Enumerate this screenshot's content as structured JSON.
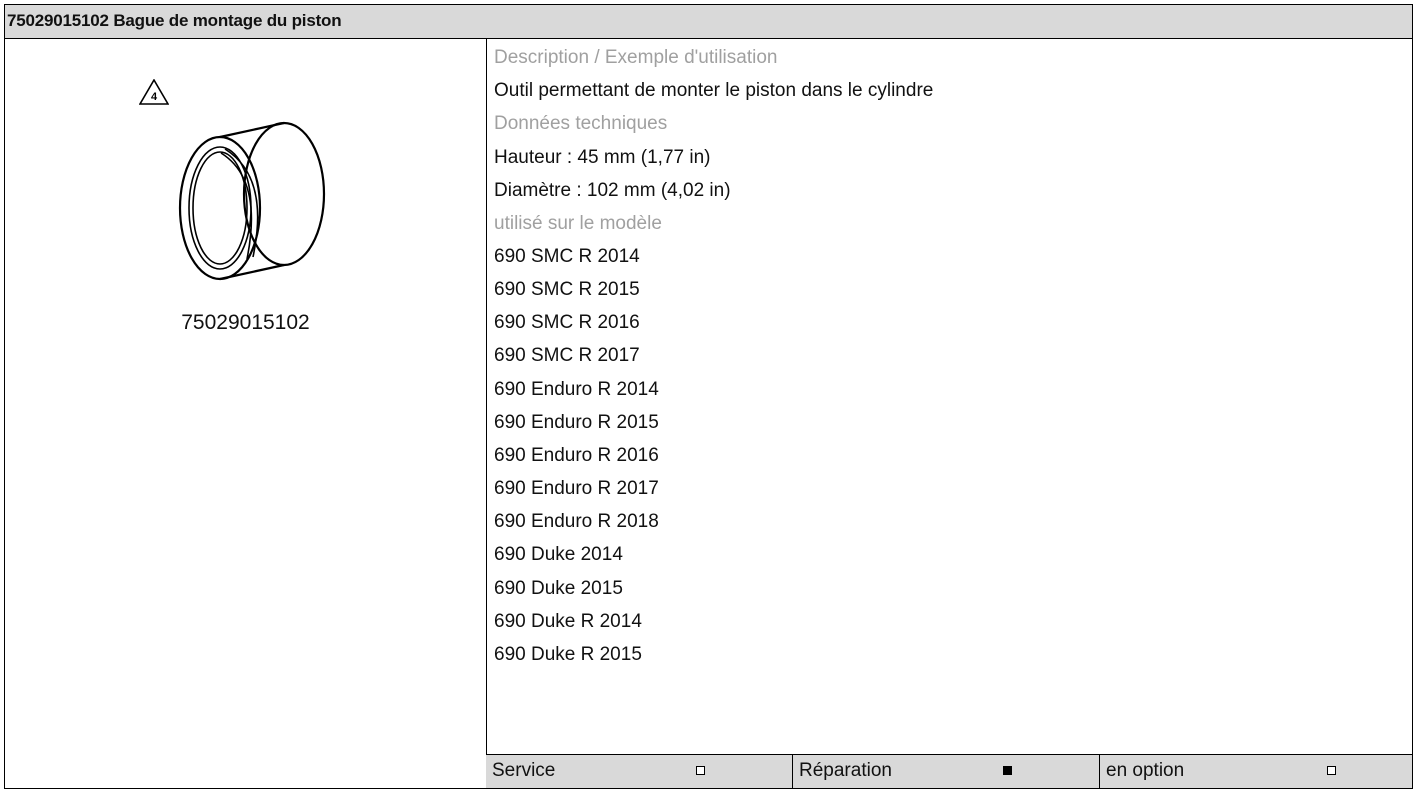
{
  "title": "75029015102 Bague de montage du piston",
  "image": {
    "warning_icon": "warning-triangle-4-icon",
    "warning_number": "4",
    "part_number_caption": "75029015102"
  },
  "details": {
    "description_heading": "Description / Exemple d'utilisation",
    "description_text": "Outil permettant de monter le piston dans le cylindre",
    "tech_heading": "Données techniques",
    "height": "Hauteur : 45 mm (1,77 in)",
    "diameter": "Diamètre : 102 mm (4,02 in)",
    "models_heading": "utilisé sur le modèle",
    "models": [
      "690 SMC R 2014",
      "690 SMC R 2015",
      "690 SMC R 2016",
      "690 SMC R 2017",
      "690 Enduro R 2014",
      "690 Enduro R 2015",
      "690 Enduro R 2016",
      "690 Enduro R 2017",
      "690 Enduro R 2018",
      "690 Duke 2014",
      "690 Duke 2015",
      "690 Duke R 2014",
      "690 Duke R 2015"
    ]
  },
  "categories": [
    {
      "label": "Service",
      "checked": false
    },
    {
      "label": "Réparation",
      "checked": true
    },
    {
      "label": "en option",
      "checked": false
    }
  ]
}
